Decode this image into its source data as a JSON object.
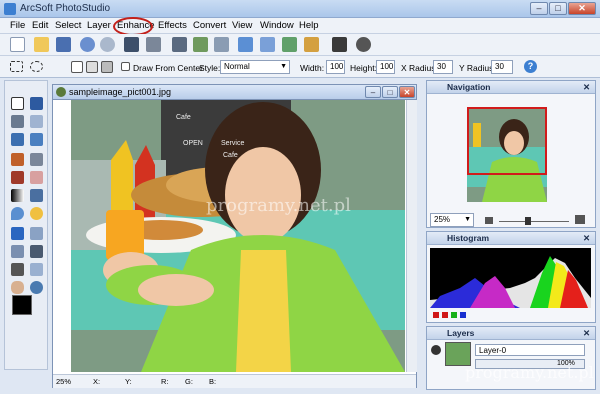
{
  "window": {
    "title": "ArcSoft PhotoStudio",
    "minimize": "–",
    "maximize": "□",
    "close": "✕"
  },
  "menu": [
    "File",
    "Edit",
    "Select",
    "Layer",
    "Enhance",
    "Effects",
    "Convert",
    "View",
    "Window",
    "Help"
  ],
  "toolbar2": {
    "draw_from_center": "Draw From Center",
    "style_label": "Style:",
    "style_value": "Normal",
    "width_label": "Width:",
    "width_value": "100",
    "height_label": "Height:",
    "height_value": "100",
    "xradius_label": "X Radius:",
    "xradius_value": "30",
    "yradius_label": "Y Radius:",
    "yradius_value": "30",
    "help_glyph": "?"
  },
  "document": {
    "filename": "sampleimage_pict001.jpg",
    "photo_signs": [
      "Cafe",
      "OPEN",
      "Service",
      "Cafe"
    ],
    "status": {
      "zoom": "25%",
      "x": "X:",
      "y": "Y:",
      "r": "R:",
      "g": "G:",
      "b": "B:"
    }
  },
  "navigation": {
    "title": "Navigation",
    "zoom": "25%",
    "close": "✕"
  },
  "histogram": {
    "title": "Histogram",
    "close": "✕"
  },
  "layers": {
    "title": "Layers",
    "close": "✕",
    "layer_name": "Layer-0",
    "opacity": "100%"
  },
  "watermark": "programy.net.pl",
  "colors": {
    "accent": "#3c7fd1",
    "highlight_ring": "#c3201a",
    "nav_frame": "#d11b1b"
  }
}
